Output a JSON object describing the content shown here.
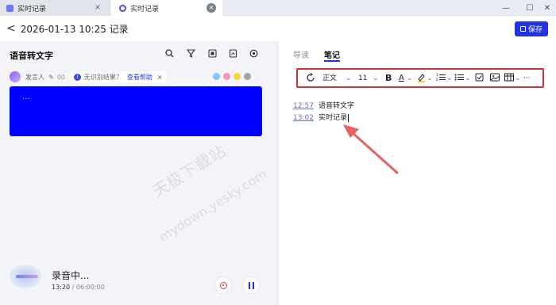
{
  "tabs": [
    {
      "label": "实时记录"
    },
    {
      "label": "实时记录"
    }
  ],
  "header": {
    "back_symbol": "<",
    "title": "2026-01-13 10:25 记录",
    "save_label": "保存"
  },
  "left": {
    "section_title": "语音转文字",
    "speaker": {
      "name": "发言人",
      "time": "00",
      "hint": "无识别结果？",
      "help_link": "查看帮助",
      "close": "×"
    },
    "color_dots": [
      "#7ec8ff",
      "#ff8fc0",
      "#ffd23a",
      "#a0a4ad"
    ],
    "transcript_placeholder": "...",
    "recording": {
      "status": "录音中...",
      "elapsed": "13:20",
      "separator": "/",
      "total": "06:00:00"
    }
  },
  "right": {
    "tabs": [
      {
        "label": "导读"
      },
      {
        "label": "笔记"
      }
    ],
    "toolbar": {
      "style_select": "正文",
      "font_size": "11",
      "bold": "B",
      "font_color": "A",
      "more": "···"
    },
    "notes": [
      {
        "time": "12:57",
        "text": "语音转文字"
      },
      {
        "time": "13:02",
        "text": "实时记录"
      }
    ]
  },
  "colors": {
    "accent": "#2233e0",
    "transcript_box": "#0000ff",
    "toolbar_highlight_border": "#d83030",
    "annotation_arrow": "#e86060"
  },
  "watermark": {
    "line1": "天极下载站",
    "line2": "mydown.yesky.com"
  }
}
